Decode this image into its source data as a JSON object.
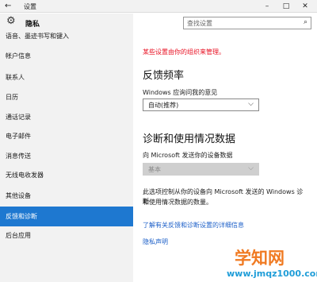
{
  "window": {
    "back": "←",
    "title": "设置",
    "min": "–",
    "max": "□",
    "close": "✕"
  },
  "sidebar": {
    "header_icon": "⚙",
    "header": "隐私",
    "items": [
      {
        "label": "语音、墨迹书写和键入"
      },
      {
        "label": "帐户信息"
      },
      {
        "label": "联系人"
      },
      {
        "label": "日历"
      },
      {
        "label": "通话记录"
      },
      {
        "label": "电子邮件"
      },
      {
        "label": "消息传送"
      },
      {
        "label": "无线电收发器"
      },
      {
        "label": "其他设备"
      },
      {
        "label": "反馈和诊断"
      },
      {
        "label": "后台应用"
      }
    ]
  },
  "search": {
    "placeholder": "查找设置",
    "icon": "⌕"
  },
  "main": {
    "note": "某些设置由你的组织来管理。",
    "feedback": {
      "heading": "反馈频率",
      "label": "Windows 应询问我的意见",
      "value": "自动(推荐)",
      "chevron": "⌵"
    },
    "diagnostics": {
      "heading": "诊断和使用情况数据",
      "label": "向 Microsoft 发送你的设备数据",
      "value": "基本",
      "chevron": "⌵",
      "desc_line1": "此选项控制从你的设备向 Microsoft 发送的 Windows 诊断",
      "desc_line2": "和使用情况数据的数量。"
    },
    "learn_more": "了解有关反馈和诊断设置的详细信息",
    "privacy": "隐私声明"
  },
  "watermark": {
    "big": "学知网",
    "small": "www.jmqz1000.com"
  }
}
